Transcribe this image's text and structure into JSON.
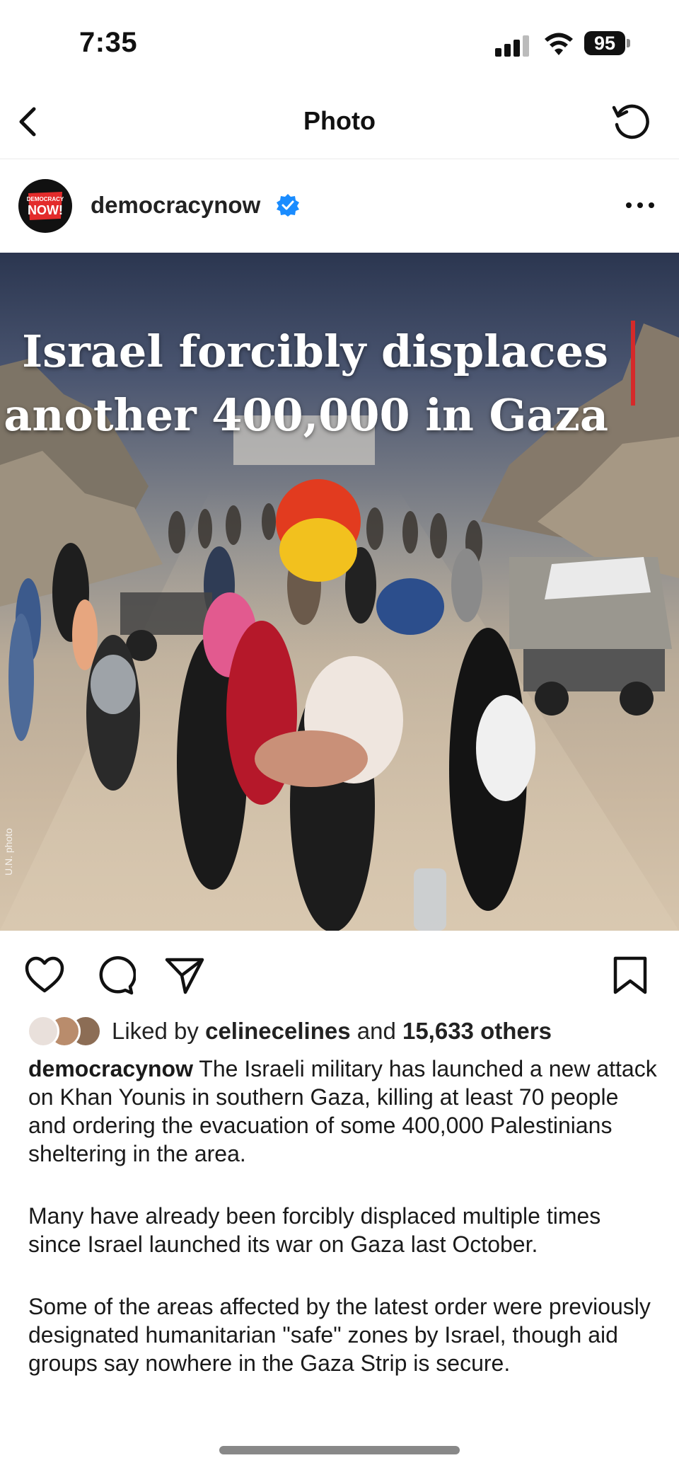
{
  "status": {
    "time": "7:35",
    "battery": "95"
  },
  "nav": {
    "title": "Photo"
  },
  "post": {
    "username": "democracynow",
    "avatar_text": "DEMOCRACY NOW!",
    "photo": {
      "headline_line1": "Israel forcibly displaces",
      "headline_line2": "another 400,000 in Gaza",
      "credit": "U.N. photo"
    },
    "likes": {
      "prefix": "Liked by",
      "user": "celinecelines",
      "mid": "and",
      "others": "15,633 others"
    },
    "caption": {
      "user": "democracynow",
      "para1": "The Israeli military has launched a new attack on Khan Younis in southern Gaza, killing at least 70 people and ordering the evacuation of some 400,000 Palestinians sheltering in the area.",
      "para2": "Many have already been forcibly displaced multiple times since Israel launched its war on Gaza last October.",
      "para3": "Some of the areas affected by the latest order were previously designated humanitarian \"safe\" zones by Israel, though aid groups say nowhere in the Gaza Strip is secure."
    }
  },
  "colors": {
    "verified": "#1a8cff",
    "accent_red": "#d52a2a"
  }
}
